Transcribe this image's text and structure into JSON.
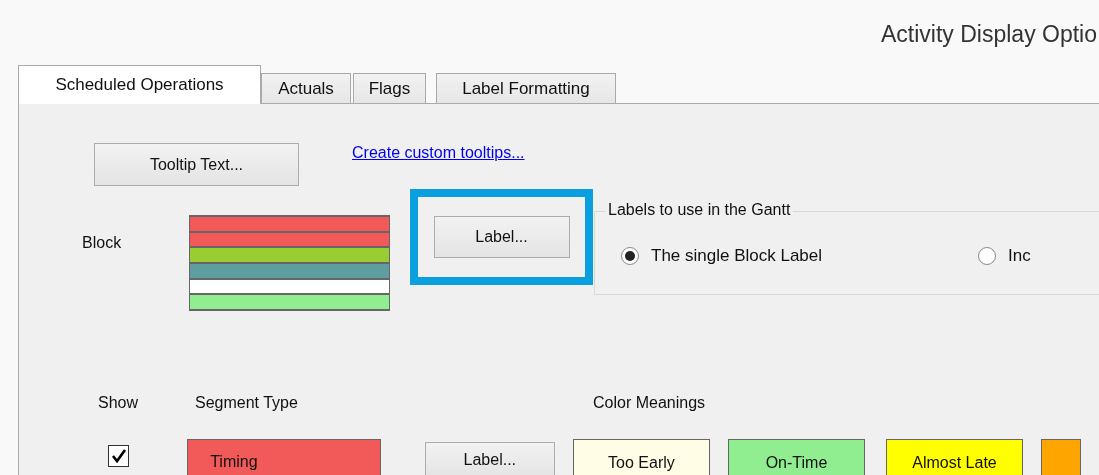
{
  "window": {
    "title": "Activity Display Optio"
  },
  "tabs": [
    {
      "label": "Scheduled Operations",
      "selected": true
    },
    {
      "label": "Actuals",
      "selected": false
    },
    {
      "label": "Flags",
      "selected": false
    },
    {
      "label": "Label Formatting",
      "selected": false
    }
  ],
  "tooltip_button": "Tooltip Text...",
  "tooltip_link": "Create custom tooltips...",
  "block": {
    "label": "Block",
    "stripes": [
      {
        "color": "#f25a5a"
      },
      {
        "color": "#f25a5a"
      },
      {
        "color": "#9acd32"
      },
      {
        "color": "#5f9ea0"
      },
      {
        "color": "#ffffff"
      },
      {
        "color": "#90ee90"
      }
    ],
    "label_button": "Label...",
    "highlighted": true
  },
  "label_group": {
    "title": "Labels to use in the Gantt",
    "options": [
      {
        "label": "The single Block Label",
        "selected": true
      },
      {
        "label": "Inc",
        "selected": false
      }
    ]
  },
  "segments": {
    "columns": [
      "Show",
      "Segment Type",
      "Color Meanings"
    ],
    "rows": [
      {
        "checked": true,
        "name": "Timing",
        "color": "#f25a5a",
        "label_button": "Label...",
        "meanings": [
          {
            "label": "Too Early",
            "color": "#fffde6"
          },
          {
            "label": "On-Time",
            "color": "#90ee90"
          },
          {
            "label": "Almost Late",
            "color": "#ffff00"
          },
          {
            "color": "#ffa500"
          }
        ]
      }
    ]
  }
}
